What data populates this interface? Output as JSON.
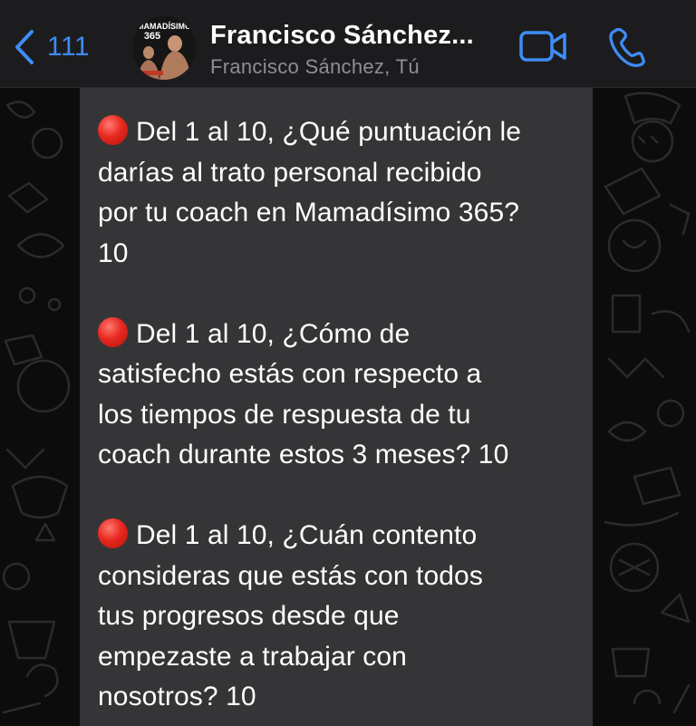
{
  "header": {
    "back_count": "111",
    "title": "Francisco Sánchez...",
    "subtitle": "Francisco Sánchez, Tú",
    "avatar_text_top": "MAMADÍSIMO",
    "avatar_text_mid": "365"
  },
  "icons": {
    "back": "chevron-left-icon",
    "video": "video-camera-icon",
    "call": "phone-icon",
    "bullet": "red-circle-icon"
  },
  "colors": {
    "accent": "#3f8cf6",
    "header_bg": "#1c1c1e",
    "bubble_bg": "#353537",
    "bullet_red": "#e8291f",
    "subtitle_gray": "#8e8e93"
  },
  "message": {
    "questions": [
      {
        "lines": [
          "Del 1 al 10, ¿Qué puntuación le",
          "darías al trato personal recibido",
          "por tu coach en Mamadísimo 365?",
          "10"
        ]
      },
      {
        "lines": [
          "Del 1 al 10, ¿Cómo de",
          "satisfecho estás con respecto a",
          "los tiempos de respuesta de tu",
          "coach durante estos 3 meses? 10"
        ]
      },
      {
        "lines": [
          "Del 1 al 10, ¿Cuán contento",
          "consideras que estás con todos",
          "tus progresos desde que",
          "empezaste a trabajar con",
          "nosotros? 10"
        ]
      }
    ]
  }
}
